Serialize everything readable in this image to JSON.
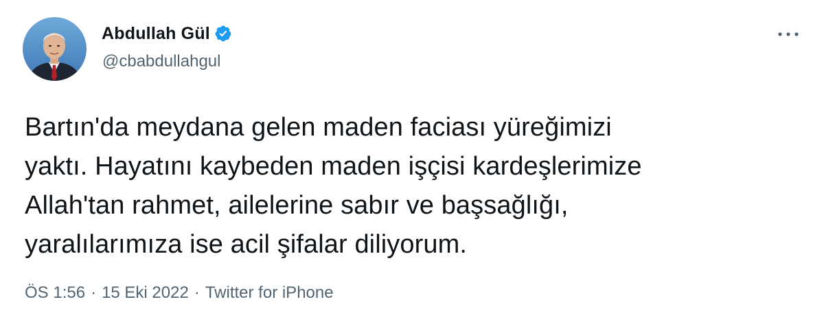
{
  "author": {
    "display_name": "Abdullah Gül",
    "handle": "@cbabdullahgul",
    "verified_icon": "verified-badge-icon",
    "avatar_icon": "profile-photo"
  },
  "menu": {
    "icon": "more-options-icon"
  },
  "tweet": {
    "lines": [
      "Bartın'da meydana gelen maden faciası yüreğimizi",
      "yaktı. Hayatını kaybeden maden işçisi kardeşlerimize",
      "Allah'tan rahmet, ailelerine sabır ve başsağlığı,",
      "yaralılarımıza ise acil şifalar diliyorum."
    ]
  },
  "meta": {
    "time": "ÖS 1:56",
    "separator_1": "·",
    "date": "15 Eki 2022",
    "separator_2": "·",
    "source": "Twitter for iPhone"
  },
  "colors": {
    "text_primary": "#0f1419",
    "text_secondary": "#536471",
    "verified_blue": "#1d9bf0",
    "background": "#ffffff"
  }
}
